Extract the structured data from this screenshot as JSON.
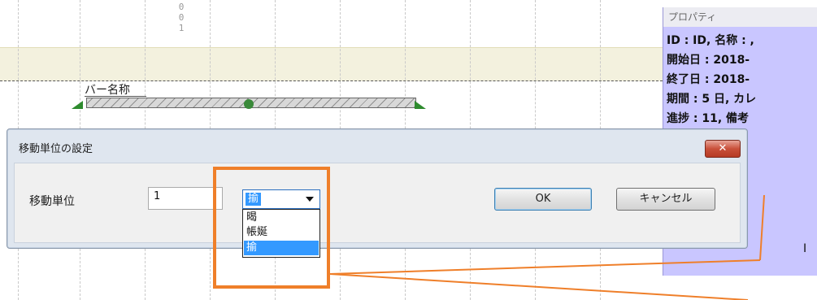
{
  "header": {
    "digits": [
      "0",
      "0",
      "1"
    ]
  },
  "gantt": {
    "bar_label": "バー名称"
  },
  "properties": {
    "title": "プロパティ",
    "lines": [
      "ID : ID, 名称 : ,",
      "開始日 : 2018-",
      "終了日 : 2018-",
      "期間 : 5 日, カレ",
      "進捗 : 11, 備考"
    ]
  },
  "dialog": {
    "title": "移動単位の設定",
    "close_label": "✕",
    "field_label": "移動単位",
    "value": "1",
    "combo_selected": "揄",
    "options": [
      "暍",
      "帳娫",
      "揄"
    ],
    "selected_option_index": 2,
    "ok_label": "OK",
    "cancel_label": "キャンセル"
  },
  "right_glyph": "I",
  "annotation_color": "#ef7f2a"
}
